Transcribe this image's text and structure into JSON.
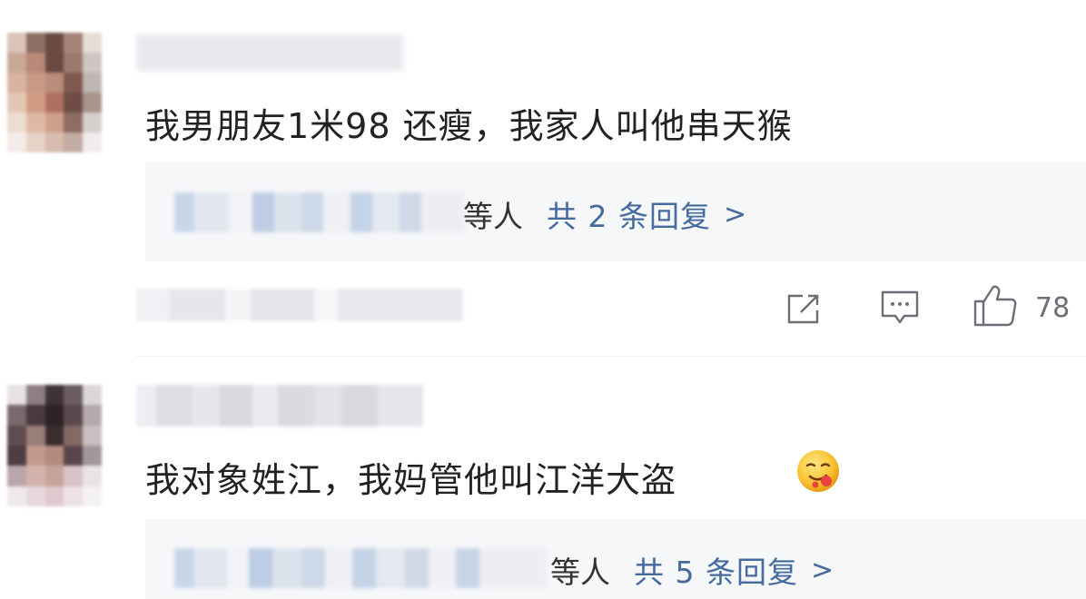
{
  "comments": [
    {
      "text": "我男朋友1米98 还瘦，我家人叫他串天猴",
      "reply_people_suffix": "等人",
      "reply_count_label": "共 2 条回复",
      "chevron": ">",
      "like_count": "78"
    },
    {
      "text": "我对象姓江，我妈管他叫江洋大盗",
      "reply_people_suffix": "等人",
      "reply_count_label": "共 5 条回复",
      "chevron": ">",
      "emoji": "drooling-face-emoji"
    }
  ],
  "icons": {
    "share": "share-icon",
    "comment": "comment-icon",
    "like": "thumbs-up-icon"
  },
  "colors": {
    "text": "#222222",
    "link": "#456a9e",
    "icon": "#6b6e75",
    "reply_panel": "#f6f7f9"
  }
}
